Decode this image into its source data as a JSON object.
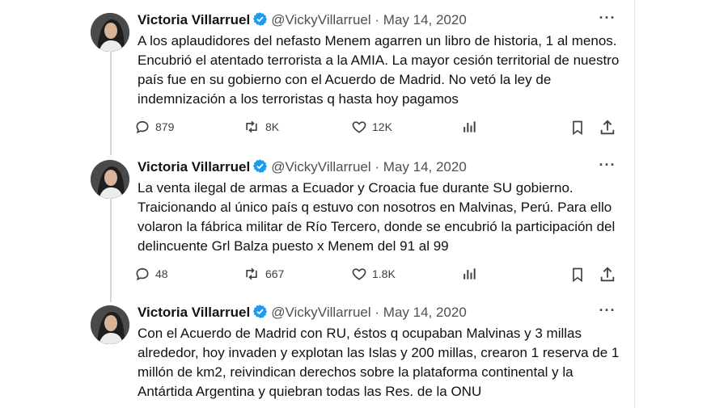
{
  "tweets": [
    {
      "author": "Victoria Villarruel",
      "handle": "@VickyVillarruel",
      "separator": "·",
      "date": "May 14, 2020",
      "more": "···",
      "text": "A los aplaudidores del nefasto Menem agarren un libro de historia, 1 al menos. Encubrió el atentado terrorista a la AMIA. La mayor cesión territorial de nuestro país fue en su gobierno con el Acuerdo de Madrid. No vetó la ley de indemnización a los terroristas q hasta hoy pagamos",
      "replies": "879",
      "reposts": "8K",
      "likes": "12K"
    },
    {
      "author": "Victoria Villarruel",
      "handle": "@VickyVillarruel",
      "separator": "·",
      "date": "May 14, 2020",
      "more": "···",
      "text": "La venta ilegal de armas a Ecuador y Croacia fue durante SU gobierno. Traicionando al único país q estuvo con nosotros en Malvinas, Perú. Para ello volaron la fábrica militar de Río Tercero, donde se encubrió la participación del delincuente Grl Balza puesto x Menem del 91 al 99",
      "replies": "48",
      "reposts": "667",
      "likes": "1.8K"
    },
    {
      "author": "Victoria Villarruel",
      "handle": "@VickyVillarruel",
      "separator": "·",
      "date": "May 14, 2020",
      "more": "···",
      "text": "Con el Acuerdo de Madrid con RU, éstos q ocupaban Malvinas y 3 millas alrededor, hoy invaden y explotan las Islas y 200 millas, crearon 1 reserva de 1 millón de km2, reivindican derechos sobre la plataforma continental y la Antártida Argentina y quiebran todas las Res. de la ONU"
    }
  ],
  "icons": {
    "reply": "reply-icon",
    "repost": "repost-icon",
    "like": "heart-icon",
    "views": "analytics-icon",
    "bookmark": "bookmark-icon",
    "share": "share-icon",
    "verified": "verified-badge-icon"
  },
  "colors": {
    "verified": "#1d9bf0",
    "text": "#0f1419",
    "muted": "#536471",
    "thread_line": "#cfd9de"
  }
}
